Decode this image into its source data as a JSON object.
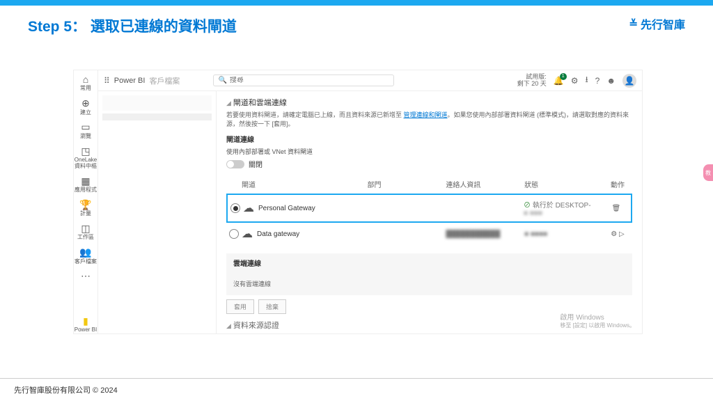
{
  "slide": {
    "title": "Step 5： 選取已連線的資料閘道",
    "brand": "先行智庫",
    "footer": "先行智庫股份有限公司  © 2024",
    "pink_tab": "教"
  },
  "rail": {
    "items": [
      "常用",
      "建立",
      "瀏覽",
      "OneLake 資料中樞",
      "應用程式",
      "計量",
      "工作區",
      "客戶檔案",
      "⋯"
    ],
    "pbi": "Power BI"
  },
  "header": {
    "product": "Power BI",
    "context": "客戶檔案",
    "search_placeholder": "搜尋",
    "trial_line1": "試用版:",
    "trial_line2": "剩下 20 天",
    "notif_count": "1"
  },
  "content": {
    "section_title": "閘道和雲端連線",
    "help_text_pre": "若要使用資料閘道，請確定電腦已上線，而且資料來源已新增至 ",
    "help_link": "管理連線和閘道",
    "help_text_post": "。如果您使用內部部署資料閘道 (標準模式)，請選取對應的資料來源，然後按一下 [套用]。",
    "gateway_conn_title": "閘道連線",
    "gateway_mode_label": "使用內部部署或 VNet 資料閘道",
    "toggle_label": "關閉",
    "columns": {
      "gateway": "閘道",
      "dept": "部門",
      "contact": "連絡人資訊",
      "status": "狀態",
      "actions": "動作"
    },
    "rows": [
      {
        "name": "Personal Gateway",
        "status": "執行於 DESKTOP-",
        "action": "🗑",
        "selected": true
      },
      {
        "name": "Data gateway",
        "status": "",
        "action": "⚙ ▷",
        "selected": false
      }
    ],
    "cloud_title": "雲端連線",
    "no_cloud": "沒有雲端連線",
    "btn_apply": "套用",
    "btn_discard": "捨棄",
    "ds_auth": "資料來源認證",
    "watermark1": "啟用 Windows",
    "watermark2": "移至 [設定] 以啟用 Windows。"
  }
}
